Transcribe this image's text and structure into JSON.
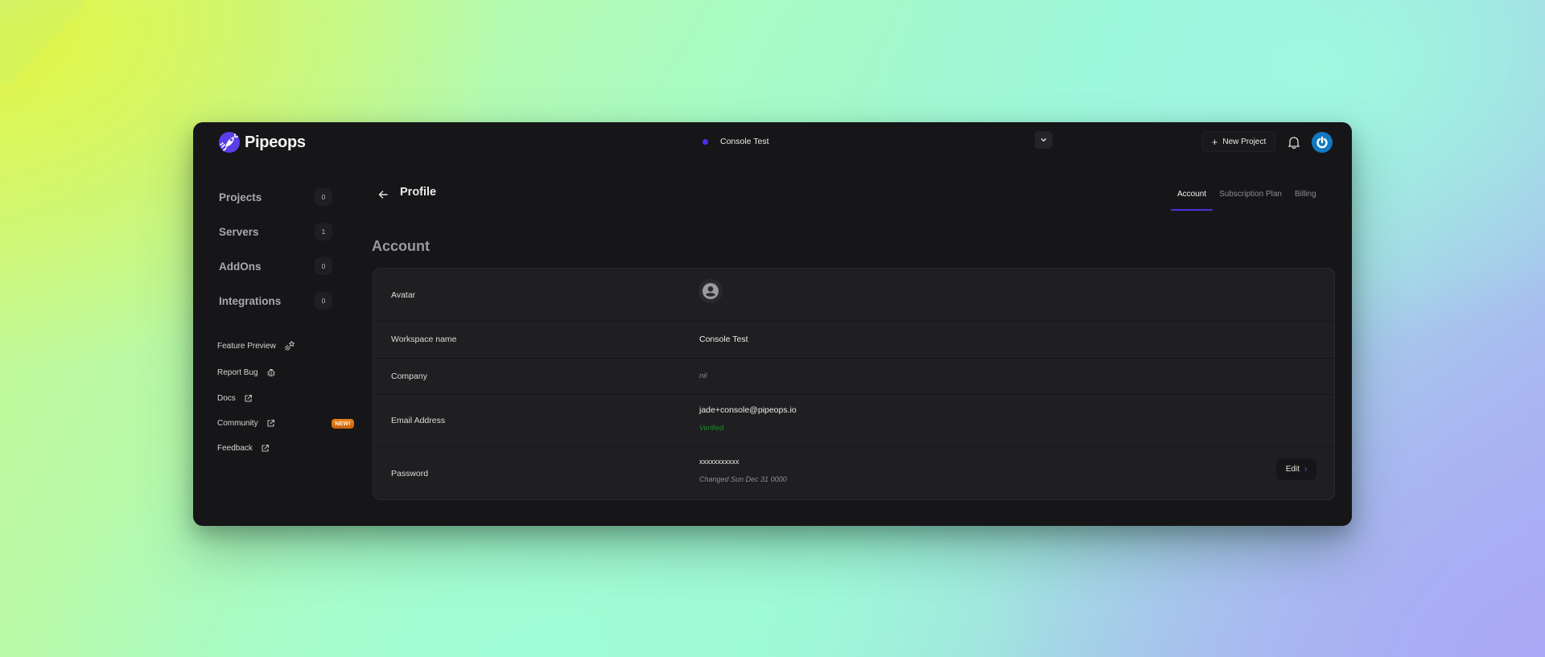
{
  "app": {
    "brand": "Pipeops",
    "brand_color": "#5b3ee8",
    "accent_color": "#4b2fe0"
  },
  "topbar": {
    "workspace": {
      "name": "Console Test",
      "status_color": "#4a2ff0",
      "dropdown_icon": "chevron-down-icon"
    },
    "new_project_label": "New Project",
    "new_project_icon": "plus-icon",
    "notifications_icon": "bell-icon",
    "user_avatar_icon": "power-icon"
  },
  "sidebar": {
    "items": [
      {
        "label": "Projects",
        "count": "0"
      },
      {
        "label": "Servers",
        "count": "1"
      },
      {
        "label": "AddOns",
        "count": "0"
      },
      {
        "label": "Integrations",
        "count": "0"
      }
    ],
    "links": [
      {
        "label": "Feature Preview",
        "icon": "shooting-star-icon"
      },
      {
        "label": "Report Bug",
        "icon": "bug-icon"
      },
      {
        "label": "Docs",
        "icon": "external-link-icon"
      },
      {
        "label": "Community",
        "icon": "external-link-icon",
        "badge": "NEW!"
      },
      {
        "label": "Feedback",
        "icon": "external-link-icon"
      }
    ]
  },
  "page": {
    "title": "Profile",
    "back_icon": "arrow-left-icon",
    "tabs": [
      {
        "label": "Account",
        "active": true
      },
      {
        "label": "Subscription Plan",
        "active": false
      },
      {
        "label": "Billing",
        "active": false
      }
    ],
    "section_title": "Account",
    "rows": {
      "avatar": {
        "label": "Avatar",
        "icon": "user-circle-icon"
      },
      "workspace": {
        "label": "Workspace name",
        "value": "Console Test"
      },
      "company": {
        "label": "Company",
        "value": "nil"
      },
      "email": {
        "label": "Email Address",
        "value": "jade+console@pipeops.io",
        "status": "Verified",
        "status_color": "#1f8a2a"
      },
      "password": {
        "label": "Password",
        "value": "xxxxxxxxxxx",
        "changed": "Changed Sun Dec 31 0000",
        "edit_label": "Edit"
      }
    }
  }
}
